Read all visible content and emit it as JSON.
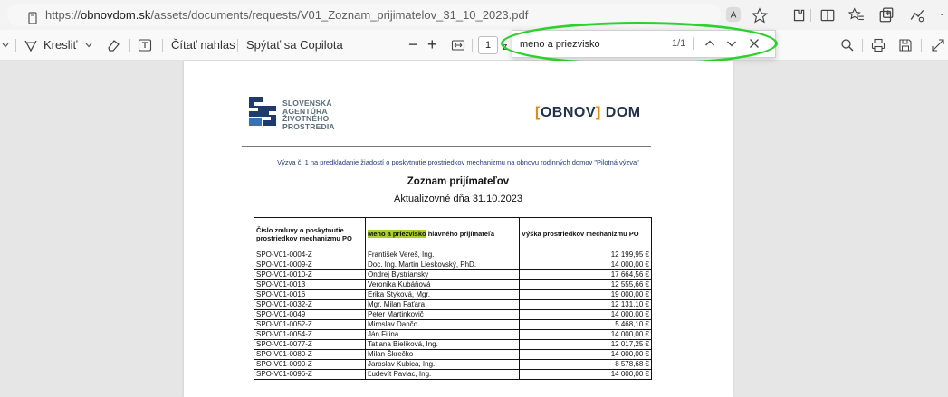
{
  "browser": {
    "url_prefix": "https://",
    "url_host": "obnovdom.sk",
    "url_path": "/assets/documents/requests/V01_Zoznam_prijimatelov_31_10_2023.pdf"
  },
  "toolbar": {
    "draw_label": "Kresliť",
    "read_aloud_label": "Čítať nahlas",
    "copilot_label": "Spýtať sa Copilota",
    "page_number": "1",
    "page_total_fragment": "z"
  },
  "find": {
    "query": "meno a priezvisko",
    "count": "1/1"
  },
  "document": {
    "agency_logo_lines": [
      "SLOVENSKÁ",
      "AGENTÚRA",
      "ŽIVOTNÉHO",
      "PROSTREDIA"
    ],
    "brand_bracket_left": "[",
    "brand_main": "OBNOV",
    "brand_bracket_right": "]",
    "brand_suffix": " DOM",
    "call_text": "Výzva č. 1 na predkladanie žiadostí o poskytnutie prostriedkov mechanizmu na obnovu rodinných domov \"Pilotná výzva\"",
    "title": "Zoznam prijímateľov",
    "subtitle": "Aktualizovné dňa 31.10.2023",
    "headers": {
      "contract": "Číslo zmluvy o poskytnutie prostriedkov mechanizmu PO",
      "name_highlight": "Meno a priezvisko",
      "name_rest": " hlavného prijímateľa",
      "amount": "Výška prostriedkov mechanizmu PO"
    },
    "rows": [
      {
        "contract": "SPO-V01-0004-Z",
        "name": "František Vereš, Ing.",
        "amount": "12 199,95 €"
      },
      {
        "contract": "SPO-V01-0009-Z",
        "name": "Doc. Ing. Martin Lieskovský, PhD.",
        "amount": "14 000,00 €"
      },
      {
        "contract": "SPO-V01-0010-Z",
        "name": "Ondrej Bystriansky",
        "amount": "17 664,56 €"
      },
      {
        "contract": "SPO-V01-0013",
        "name": "Veronika Kubáňová",
        "amount": "12 555,66 €"
      },
      {
        "contract": "SPO-V01-0016",
        "name": "Erika Styková, Mgr.",
        "amount": "19 000,00 €"
      },
      {
        "contract": "SPO-V01-0032-Z",
        "name": "Mgr. Milan Faťara",
        "amount": "12 131,10 €"
      },
      {
        "contract": "SPO-V01-0049",
        "name": "Peter Martinkovič",
        "amount": "14 000,00 €"
      },
      {
        "contract": "SPO-V01-0052-Z",
        "name": "Miroslav Dančo",
        "amount": "5 468,10 €"
      },
      {
        "contract": "SPO-V01-0054-Z",
        "name": "Ján Filina",
        "amount": "14 000,00 €"
      },
      {
        "contract": "SPO-V01-0077-Z",
        "name": "Tatiana Bieliková, Ing.",
        "amount": "12 017,25 €"
      },
      {
        "contract": "SPO-V01-0080-Z",
        "name": "Milan Škrečko",
        "amount": "14 000,00 €"
      },
      {
        "contract": "SPO-V01-0090-Z",
        "name": "Jaroslav Kubica, Ing.",
        "amount": "8 578,68 €"
      },
      {
        "contract": "SPO-V01-0096-Z",
        "name": "Ľudevít Pavlac, Ing.",
        "amount": "14 000,00 €"
      }
    ]
  },
  "colors": {
    "highlight": "#a9d12a",
    "annotation_ellipse": "#2dd12d",
    "call_text": "#1f3b7a"
  }
}
